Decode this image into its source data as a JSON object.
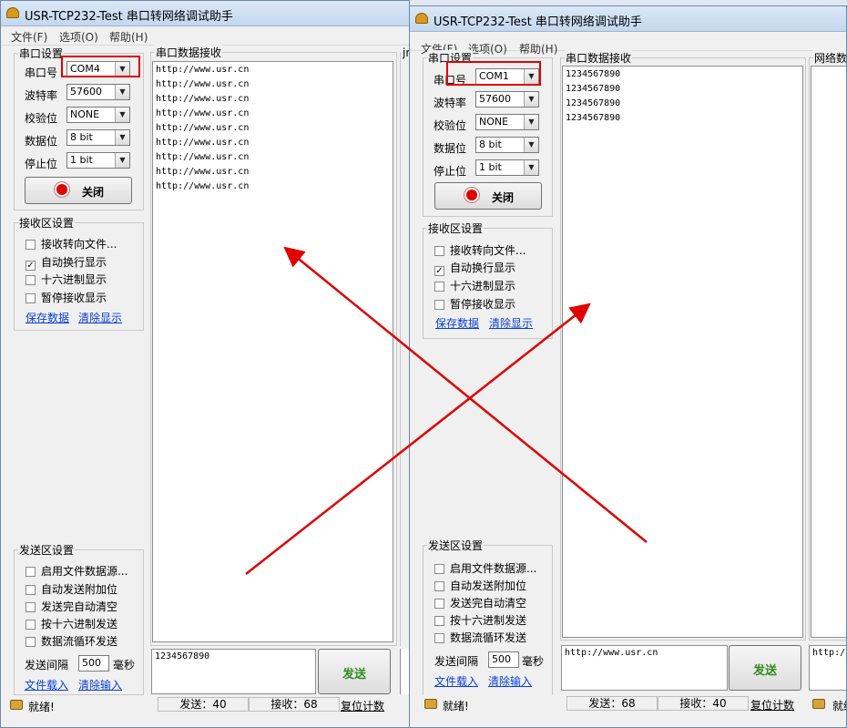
{
  "app_title": "USR-TCP232-Test 串口转网络调试助手",
  "menu": [
    "文件(F)",
    "选项(O)",
    "帮助(H)"
  ],
  "serial_settings": {
    "group_title": "串口设置",
    "port_label": "串口号",
    "baud_label": "波特率",
    "parity_label": "校验位",
    "databits_label": "数据位",
    "stopbits_label": "停止位"
  },
  "recv_settings": {
    "group_title": "接收区设置",
    "options": [
      "接收转向文件...",
      "自动换行显示",
      "十六进制显示",
      "暂停接收显示"
    ],
    "save_link": "保存数据",
    "clear_link": "清除显示"
  },
  "send_settings": {
    "group_title": "发送区设置",
    "options": [
      "启用文件数据源...",
      "自动发送附加位",
      "发送完自动清空",
      "按十六进制发送",
      "数据流循环发送"
    ],
    "interval_label": "发送间隔",
    "interval_value": "500",
    "interval_unit": "毫秒",
    "load_link": "文件载入",
    "clear_link": "清除输入"
  },
  "recv_panel_title": "串口数据接收",
  "net_panel_title": "网络数",
  "close_button": "关闭",
  "send_button": "发送",
  "ready_text": "就绪!",
  "reset_link": "复位计数",
  "left": {
    "port": "COM4",
    "baud": "57600",
    "parity": "NONE",
    "databits": "8 bit",
    "stopbits": "1 bit",
    "recv_lines": [
      "http://www.usr.cn",
      "http://www.usr.cn",
      "http://www.usr.cn",
      "http://www.usr.cn",
      "http://www.usr.cn",
      "http://www.usr.cn",
      "http://www.usr.cn",
      "http://www.usr.cn",
      "http://www.usr.cn"
    ],
    "send_text": "1234567890",
    "sent": "发送：40",
    "received": "接收：68",
    "net_fragment": "jn"
  },
  "right": {
    "port": "COM1",
    "baud": "57600",
    "parity": "NONE",
    "databits": "8 bit",
    "stopbits": "1 bit",
    "recv_lines": [
      "1234567890",
      "1234567890",
      "1234567890",
      "1234567890"
    ],
    "send_text": "http://www.usr.cn",
    "sent": "发送：68",
    "received": "接收：40",
    "net_fragment": "http:/",
    "ready_fragment": "就绪"
  },
  "colors": {
    "annotation_red": "#e00000",
    "link_blue": "#0a3fd6",
    "send_green": "#2f8a1f"
  }
}
